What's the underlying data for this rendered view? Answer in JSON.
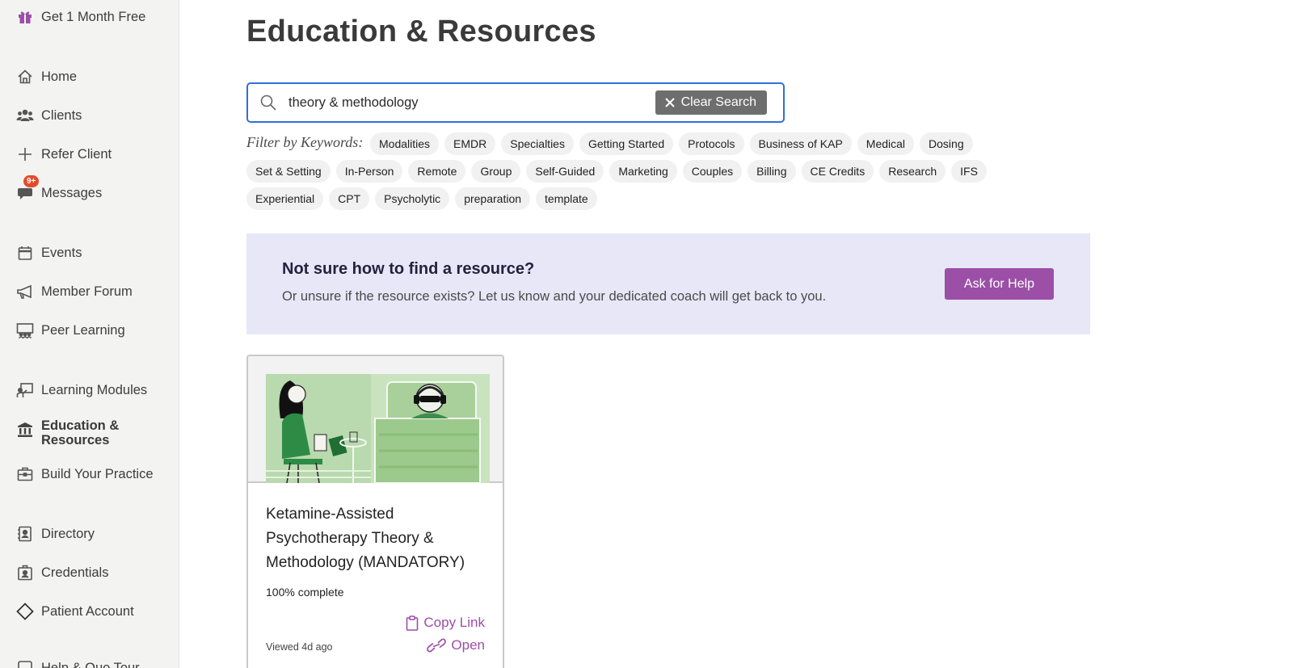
{
  "sidebar": {
    "items": [
      {
        "label": "Get 1 Month Free",
        "icon": "gift-icon"
      },
      {
        "label": "Home",
        "icon": "home-icon"
      },
      {
        "label": "Clients",
        "icon": "users-icon"
      },
      {
        "label": "Refer Client",
        "icon": "plus-icon"
      },
      {
        "label": "Messages",
        "icon": "chat-icon",
        "badge": "9+"
      },
      {
        "label": "Events",
        "icon": "calendar-icon"
      },
      {
        "label": "Member Forum",
        "icon": "megaphone-icon"
      },
      {
        "label": "Peer Learning",
        "icon": "group-presentation-icon"
      },
      {
        "label": "Learning Modules",
        "icon": "teacher-board-icon"
      },
      {
        "label": "Education & Resources",
        "icon": "institution-icon",
        "active": true
      },
      {
        "label": "Build Your Practice",
        "icon": "briefcase-icon"
      },
      {
        "label": "Directory",
        "icon": "address-book-icon"
      },
      {
        "label": "Credentials",
        "icon": "id-badge-icon"
      },
      {
        "label": "Patient Account",
        "icon": "diamond-icon"
      },
      {
        "label": "Help & Quo Tour",
        "icon": "help-icon"
      }
    ]
  },
  "main": {
    "title": "Education & Resources",
    "search": {
      "value": "theory & methodology",
      "clear_label": "Clear Search"
    },
    "filter_label": "Filter by Keywords:",
    "keywords": [
      [
        "Modalities",
        "EMDR",
        "Specialties",
        "Getting Started",
        "Protocols",
        "Business of KAP",
        "Medical",
        "Dosing"
      ],
      [
        "Set & Setting",
        "In-Person",
        "Remote",
        "Group",
        "Self-Guided",
        "Marketing",
        "Couples",
        "Billing",
        "CE Credits",
        "Research",
        "IFS"
      ],
      [
        "Experiential",
        "CPT",
        "Psycholytic",
        "preparation",
        "template"
      ]
    ],
    "help": {
      "title": "Not sure how to find a resource?",
      "subtitle": "Or unsure if the resource exists? Let us know and your dedicated coach will get back to you.",
      "button": "Ask for Help"
    },
    "card": {
      "title": "Ketamine-Assisted Psychotherapy Theory & Methodology (MANDATORY)",
      "progress": "100% complete",
      "copy_label": "Copy Link",
      "open_label": "Open",
      "viewed": "Viewed 4d ago"
    }
  },
  "colors": {
    "accent": "#9b4fa6",
    "search_border": "#2f6fdb",
    "banner_bg": "#e7e7f8",
    "badge": "#e44b28"
  }
}
